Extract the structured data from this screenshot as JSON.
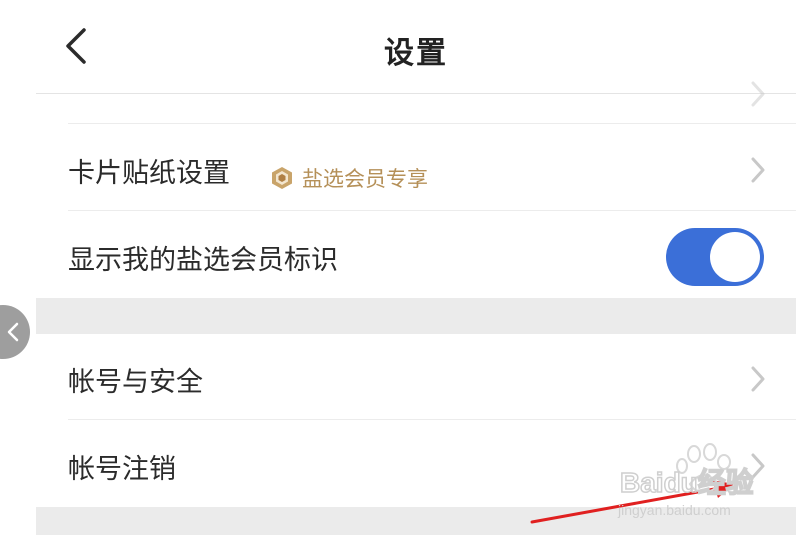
{
  "header": {
    "title": "设置"
  },
  "settings": {
    "card_sticker": {
      "label": "卡片贴纸设置",
      "badge_text": "盐选会员专享"
    },
    "show_badge": {
      "label": "显示我的盐选会员标识",
      "toggle_on": true
    },
    "account_security": {
      "label": "帐号与安全"
    },
    "account_cancel": {
      "label": "帐号注销"
    }
  },
  "watermark": {
    "brand": "Baidu经验",
    "url": "jingyan.baidu.com"
  },
  "colors": {
    "accent_blue": "#3b6fd8",
    "badge_gold": "#b59058",
    "section_gap": "#ebebeb",
    "annotation_red": "#e02020"
  },
  "icons": {
    "back": "chevron-left-icon",
    "row_nav": "chevron-right-icon",
    "badge": "crown-hexagon-icon",
    "side_back": "side-back-icon"
  }
}
